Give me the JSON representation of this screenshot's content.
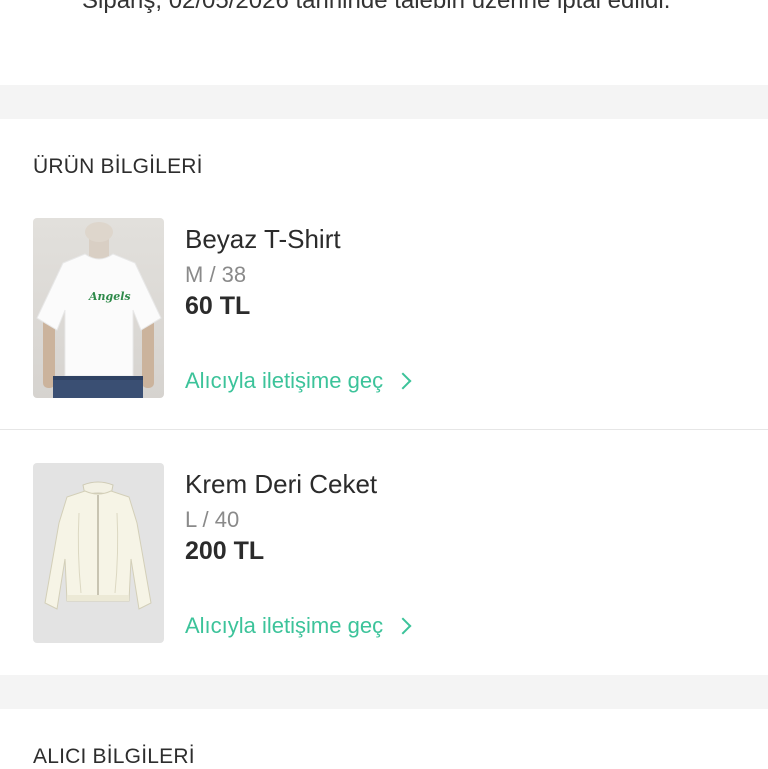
{
  "notice": {
    "text": "Sipariş, 02/05/2026 tarihinde talebin üzerine iptal edildi."
  },
  "product_section": {
    "title": "ÜRÜN BİLGİLERİ"
  },
  "products": [
    {
      "name": "Beyaz T-Shirt",
      "size": "M / 38",
      "price": "60 TL",
      "contact_label": "Alıcıyla iletişime geç",
      "image_text": "Angels"
    },
    {
      "name": "Krem Deri Ceket",
      "size": "L / 40",
      "price": "200 TL",
      "contact_label": "Alıcıyla iletişime geç"
    }
  ],
  "buyer_section": {
    "title": "ALICI BİLGİLERİ"
  },
  "colors": {
    "accent": "#3cc39a",
    "separator": "#f4f4f4"
  },
  "icons": [
    "chevron-right-icon"
  ]
}
